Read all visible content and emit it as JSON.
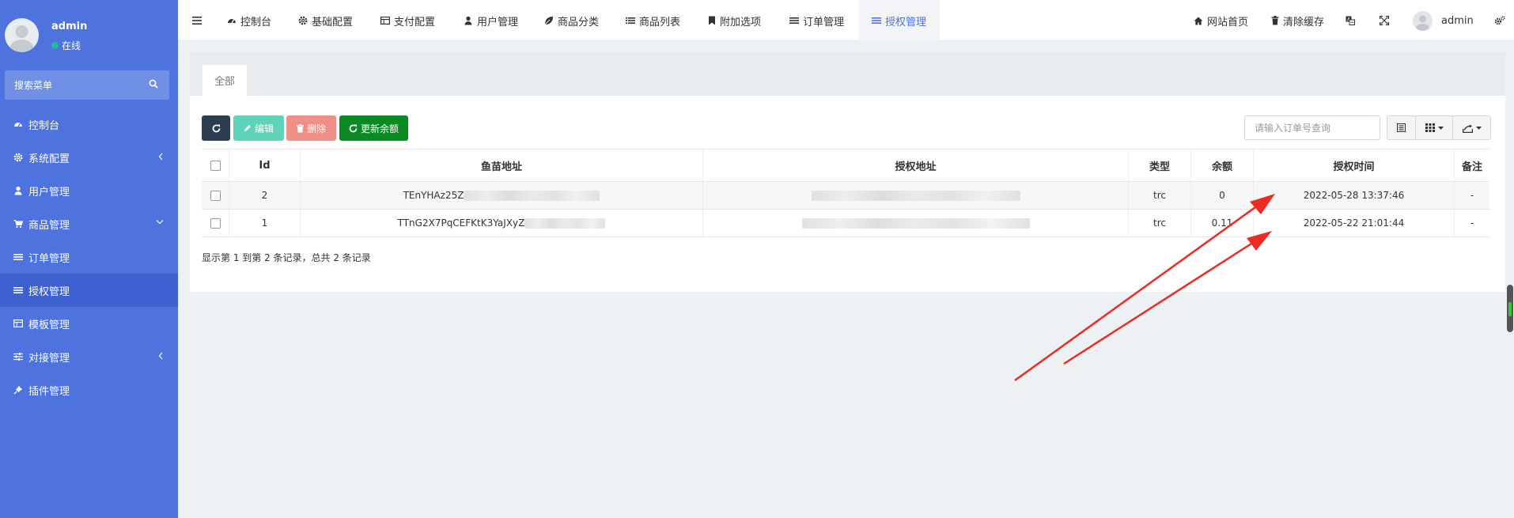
{
  "user": {
    "name": "admin",
    "status": "在线"
  },
  "sidebar": {
    "search_placeholder": "搜索菜单",
    "items": [
      {
        "label": "控制台",
        "icon": "dashboard-icon"
      },
      {
        "label": "系统配置",
        "icon": "gear-icon",
        "arrow": "left"
      },
      {
        "label": "用户管理",
        "icon": "user-icon"
      },
      {
        "label": "商品管理",
        "icon": "cart-icon",
        "arrow": "down"
      },
      {
        "label": "订单管理",
        "icon": "list-icon"
      },
      {
        "label": "授权管理",
        "icon": "list-icon",
        "active": true
      },
      {
        "label": "模板管理",
        "icon": "table-icon"
      },
      {
        "label": "对接管理",
        "icon": "sliders-icon",
        "arrow": "left"
      },
      {
        "label": "插件管理",
        "icon": "plug-icon"
      }
    ]
  },
  "topnav": {
    "tabs": [
      {
        "label": "控制台",
        "icon": "dashboard-icon"
      },
      {
        "label": "基础配置",
        "icon": "gear-icon"
      },
      {
        "label": "支付配置",
        "icon": "table-icon"
      },
      {
        "label": "用户管理",
        "icon": "user-icon"
      },
      {
        "label": "商品分类",
        "icon": "leaf-icon"
      },
      {
        "label": "商品列表",
        "icon": "list-icon"
      },
      {
        "label": "附加选项",
        "icon": "bookmark-icon"
      },
      {
        "label": "订单管理",
        "icon": "list-icon"
      },
      {
        "label": "授权管理",
        "icon": "list-icon",
        "active": true
      }
    ],
    "right": {
      "home": "网站首页",
      "clear_cache": "清除缓存",
      "admin": "admin"
    }
  },
  "panel": {
    "tab_all": "全部",
    "buttons": {
      "edit": "编辑",
      "delete": "删除",
      "update_balance": "更新余额"
    },
    "search_placeholder": "请输入订单号查询",
    "columns": [
      "Id",
      "鱼苗地址",
      "授权地址",
      "类型",
      "余额",
      "授权时间",
      "备注"
    ],
    "rows": [
      {
        "id": "2",
        "fish_address": "TEnYHAz25Z",
        "auth_address": "",
        "type": "trc",
        "balance": "0",
        "auth_time": "2022-05-28 13:37:46",
        "remark": "-"
      },
      {
        "id": "1",
        "fish_address": "TTnG2X7PqCEFKtK3YaJXyZ",
        "auth_address": "",
        "type": "trc",
        "balance": "0.11",
        "auth_time": "2022-05-22 21:01:44",
        "remark": "-"
      }
    ],
    "footer": "显示第 1 到第 2 条记录，总共 2 条记录"
  },
  "colors": {
    "sidebar": "#4e73df",
    "edit_button": "#5fd3b9",
    "delete_button": "#ef8f85",
    "update_button": "#0b8a24",
    "refresh_button": "#2c3e50",
    "annotation_arrow": "#ee2b22"
  }
}
